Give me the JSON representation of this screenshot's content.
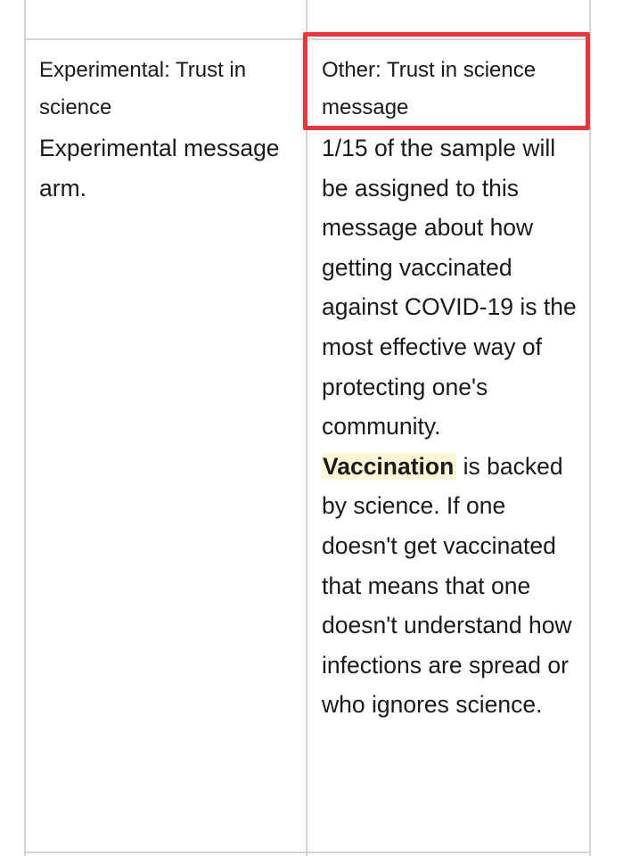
{
  "table": {
    "left": {
      "label": "Experimental: Trust in science",
      "description": "Experimental message arm."
    },
    "right": {
      "label": "Other: Trust in science message",
      "description_before": "1/15 of the sample will be assigned to this message about how getting vaccinated against COVID-19 is the most effective way of protecting one's community. ",
      "highlight": "Vaccination",
      "description_after": " is backed by science. If one doesn't get vaccinated that means that one doesn't understand how infections are spread or who ignores science."
    }
  },
  "colors": {
    "callout_border": "#e0393e",
    "highlight_bg": "#fff6d6",
    "grid_line": "#d4d4d4"
  }
}
